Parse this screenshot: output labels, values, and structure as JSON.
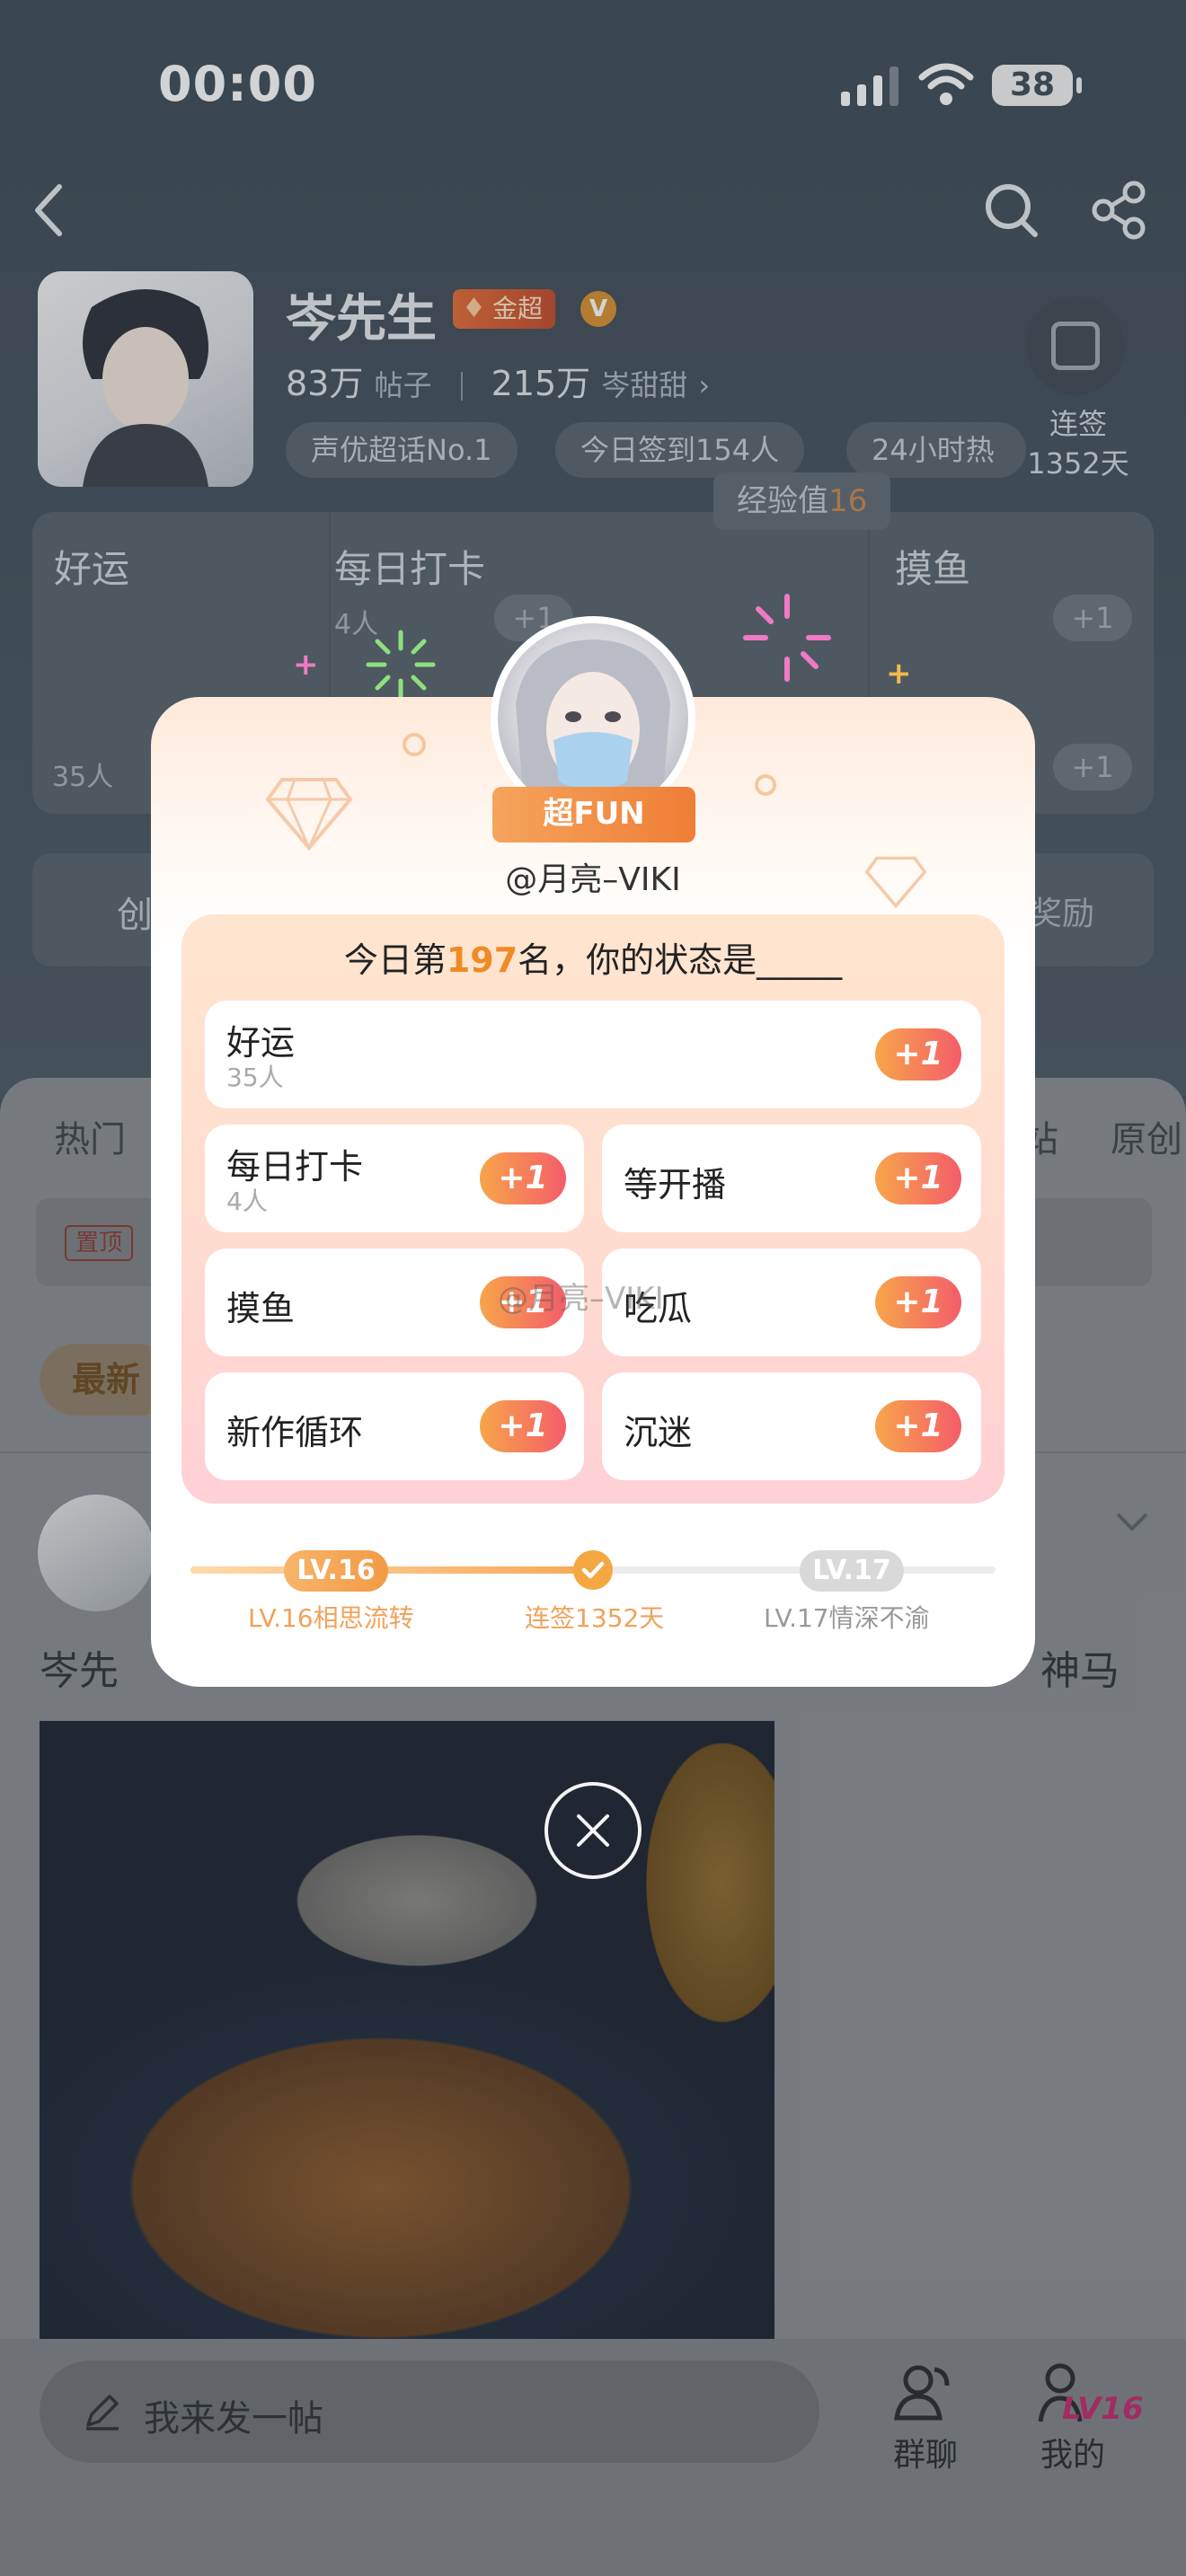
{
  "status_bar": {
    "time": "00:00",
    "battery": "38"
  },
  "topic": {
    "title": "岑先生",
    "badge": "金超",
    "posts_count": "83万",
    "posts_label": "帖子",
    "fans_count": "215万",
    "fans_label": "岑甜甜",
    "tags": [
      "声优超话No.1",
      "今日签到154人",
      "24小时热"
    ],
    "checkin_label": "连签",
    "checkin_days": "1352天",
    "exp_tip_label": "经验值",
    "exp_tip_value": "16"
  },
  "background_grid": {
    "cells": [
      {
        "title": "好运",
        "sub": "35人"
      },
      {
        "title": "每日打卡",
        "sub": "4人"
      },
      {
        "title": "摸鱼",
        "sub": ""
      }
    ],
    "plus": "+1"
  },
  "create_row": {
    "left": "创",
    "right": "奖励"
  },
  "tabs": [
    "热门",
    "站",
    "原创"
  ],
  "pin_label": "置顶",
  "latest_chip": "最新",
  "post": {
    "text_left": "岑先",
    "text_right": "神马"
  },
  "modal": {
    "fan_badge": "超FUN",
    "username": "@月亮–VIKI",
    "rank_prefix": "今日第",
    "rank_number": "197",
    "rank_suffix": "名，你的状态是_____",
    "moods": [
      {
        "title": "好运",
        "sub": "35人"
      },
      {
        "title": "每日打卡",
        "sub": "4人"
      },
      {
        "title": "等开播",
        "sub": ""
      },
      {
        "title": "摸鱼",
        "sub": ""
      },
      {
        "title": "吃瓜",
        "sub": ""
      },
      {
        "title": "新作循环",
        "sub": ""
      },
      {
        "title": "沉迷",
        "sub": ""
      }
    ],
    "plus_label": "+1",
    "watermark": "@月亮–VIKI",
    "progress": {
      "fraction": 0.5,
      "current_level": "LV.16",
      "next_level": "LV.17",
      "current_label": "LV.16相思流转",
      "middle_label": "连签1352天",
      "next_label": "LV.17情深不渝"
    }
  },
  "bottom_bar": {
    "compose_placeholder": "我来发一帖",
    "group_label": "群聊",
    "me_label": "我的",
    "me_level": "LV16"
  },
  "colors": {
    "accent_orange": "#f08a25",
    "plus_gradient_start": "#f7a54a",
    "plus_gradient_end": "#f45d6a"
  }
}
